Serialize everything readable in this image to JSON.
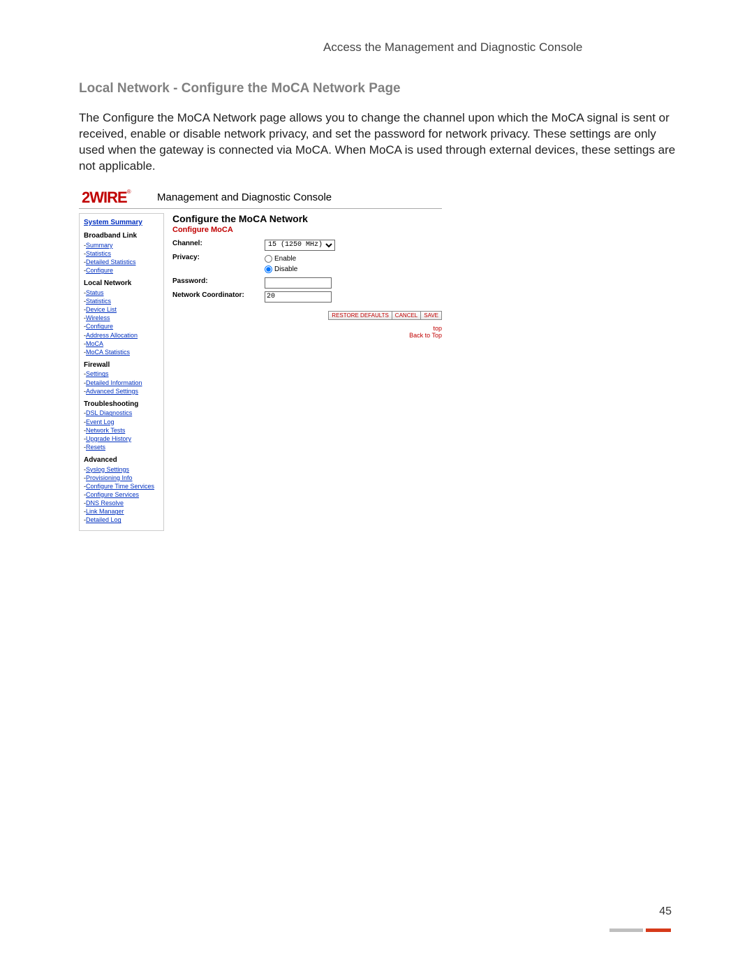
{
  "breadcrumb": "Access the Management and Diagnostic Console",
  "page_title": "Local Network - Configure the MoCA Network Page",
  "body_text": "The Configure the MoCA Network page allows you to change the channel upon which the MoCA signal is sent or received, enable or disable network privacy, and set the password for network privacy. These settings are only used when the gateway is connected via MoCA. When MoCA is used through external devices, these settings are not applicable.",
  "logo_text": "2WIRE",
  "logo_mark": "®",
  "console_title": "Management and Diagnostic Console",
  "sidebar": {
    "top": "System Summary",
    "sections": [
      {
        "title": "Broadband Link",
        "links": [
          "Summary",
          "Statistics",
          "Detailed Statistics",
          "Configure"
        ]
      },
      {
        "title": "Local Network",
        "links": [
          "Status",
          "Statistics",
          "Device List",
          "Wireless",
          "Configure",
          "Address Allocation",
          "MoCA",
          "MoCA Statistics"
        ]
      },
      {
        "title": "Firewall",
        "links": [
          "Settings",
          "Detailed Information",
          "Advanced Settings"
        ]
      },
      {
        "title": "Troubleshooting",
        "links": [
          "DSL Diagnostics",
          "Event Log",
          "Network Tests",
          "Upgrade History",
          "Resets"
        ]
      },
      {
        "title": "Advanced",
        "links": [
          "Syslog Settings",
          "Provisioning Info",
          "Configure Time Services",
          "Configure Services",
          "DNS Resolve",
          "Link Manager",
          "Detailed Log"
        ]
      }
    ]
  },
  "main": {
    "title": "Configure the MoCA Network",
    "subtitle": "Configure MoCA",
    "labels": {
      "channel": "Channel:",
      "privacy": "Privacy:",
      "password": "Password:",
      "coordinator": "Network Coordinator:"
    },
    "channel_value": "15 (1250 MHz)",
    "privacy_enable": "Enable",
    "privacy_disable": "Disable",
    "password_value": "",
    "coordinator_value": "20",
    "buttons": {
      "restore": "RESTORE DEFAULTS",
      "cancel": "CANCEL",
      "save": "SAVE"
    },
    "footer1": "top",
    "footer2": "Back to Top"
  },
  "page_number": "45"
}
